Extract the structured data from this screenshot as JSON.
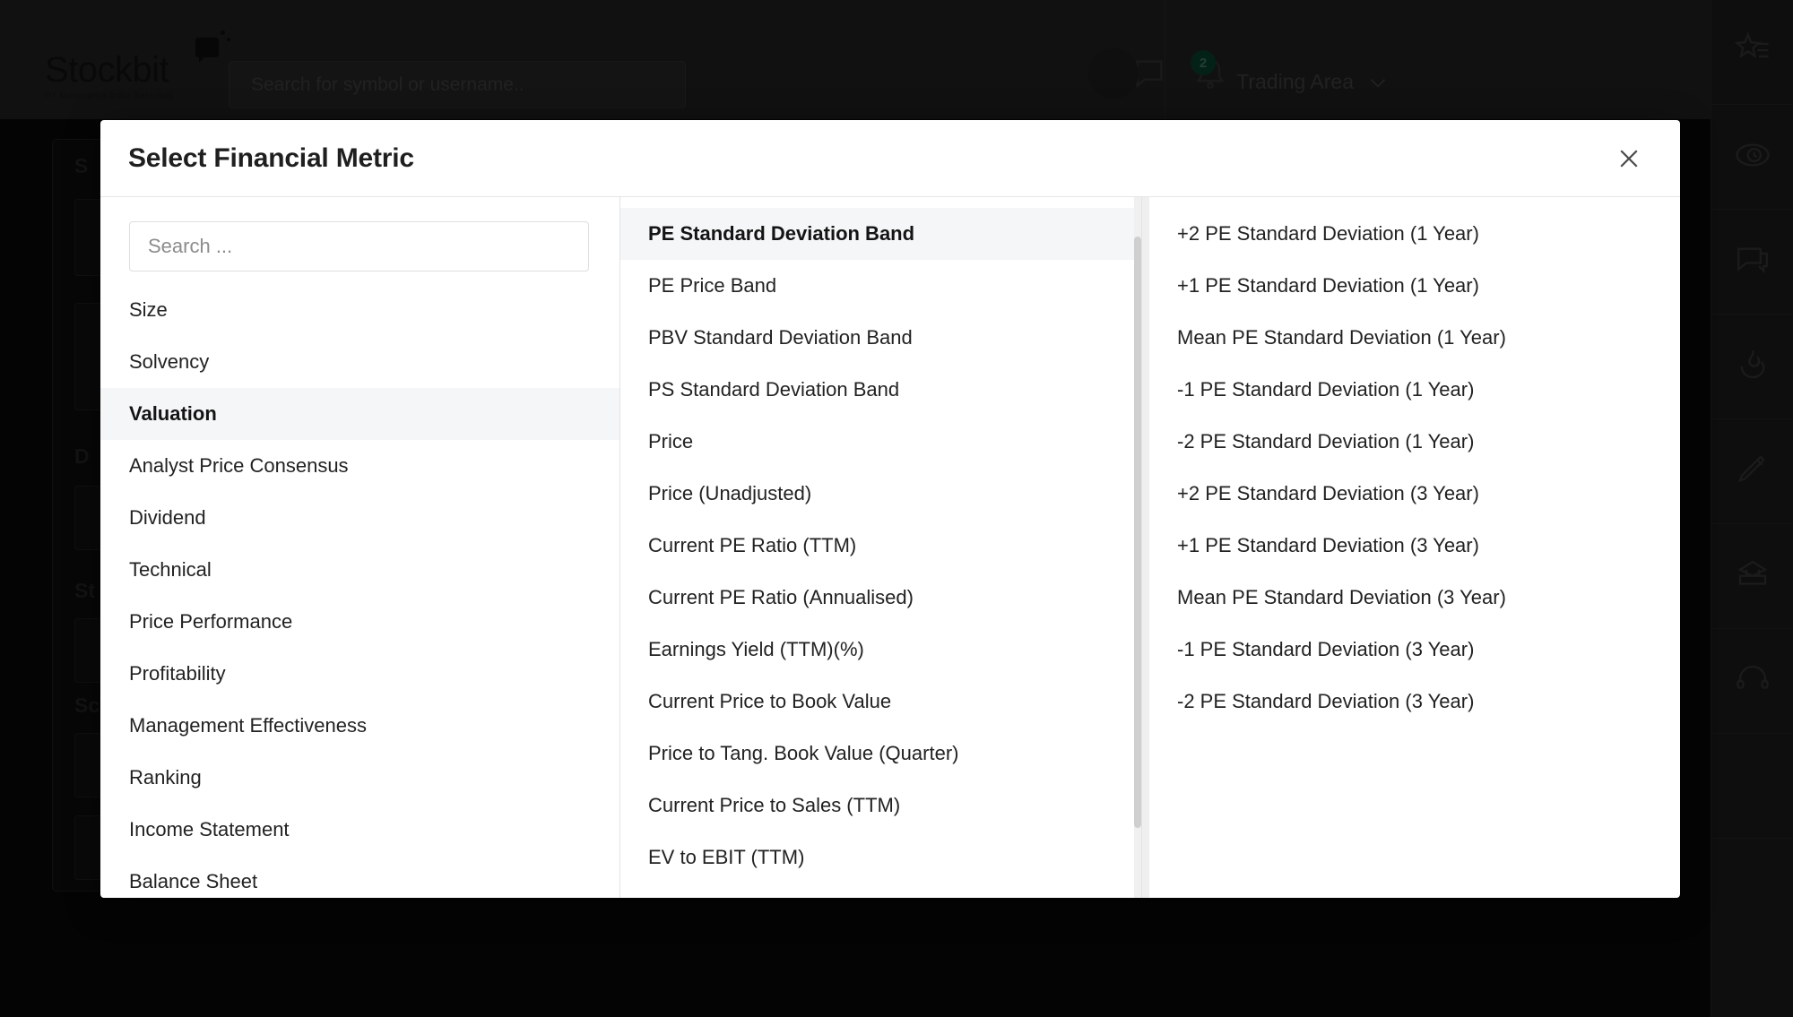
{
  "app": {
    "brand": "Stockbit",
    "brand_subtitle": "PT Mahakarya Artha Sekuritas",
    "search_placeholder": "Search for symbol or username..",
    "notification_count": "2",
    "trading_area_label": "Trading Area",
    "rail_icons": [
      "star-list-icon",
      "watchlist-clock-icon",
      "chat-bubble-icon",
      "trending-fire-icon",
      "pencil-icon",
      "calendar-icon",
      "headset-support-icon"
    ],
    "background_labels": [
      "S",
      "D",
      "St",
      "Sc"
    ]
  },
  "modal": {
    "title": "Select Financial Metric",
    "close_icon": "close-icon",
    "search": {
      "placeholder": "Search ...",
      "value": ""
    },
    "categories": {
      "selected": "Valuation",
      "items": [
        "Size",
        "Solvency",
        "Valuation",
        "Analyst Price Consensus",
        "Dividend",
        "Technical",
        "Price Performance",
        "Profitability",
        "Management Effectiveness",
        "Ranking",
        "Income Statement",
        "Balance Sheet"
      ]
    },
    "metrics": {
      "selected": "PE Standard Deviation Band",
      "items": [
        "PE Standard Deviation Band",
        "PE Price Band",
        "PBV Standard Deviation Band",
        "PS Standard Deviation Band",
        "Price",
        "Price (Unadjusted)",
        "Current PE Ratio (TTM)",
        "Current PE Ratio (Annualised)",
        "Earnings Yield (TTM)(%)",
        "Current Price to Book Value",
        "Price to Tang. Book Value (Quarter)",
        "Current Price to Sales (TTM)",
        "EV to EBIT (TTM)"
      ]
    },
    "fields": {
      "items": [
        "+2 PE Standard Deviation (1 Year)",
        "+1 PE Standard Deviation (1 Year)",
        "Mean PE Standard Deviation (1 Year)",
        "-1 PE Standard Deviation (1 Year)",
        "-2 PE Standard Deviation (1 Year)",
        "+2 PE Standard Deviation (3 Year)",
        "+1 PE Standard Deviation (3 Year)",
        "Mean PE Standard Deviation (3 Year)",
        "-1 PE Standard Deviation (3 Year)",
        "-2 PE Standard Deviation (3 Year)"
      ]
    }
  },
  "colors": {
    "modal_bg": "#ffffff",
    "selected_row": "#f4f6f7",
    "topbar": "#262626",
    "badge_green": "#0b4a33"
  }
}
